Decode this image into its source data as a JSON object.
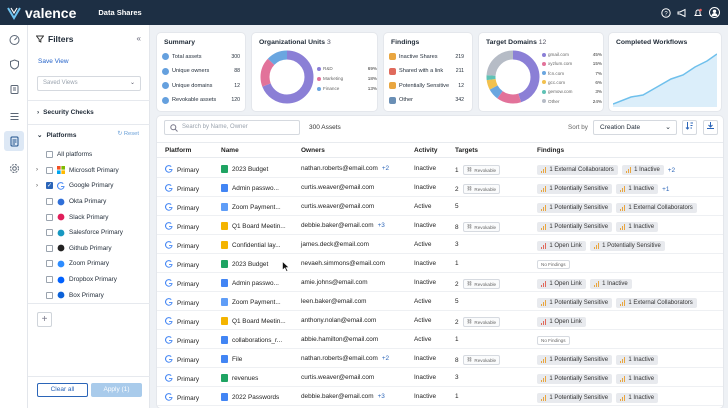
{
  "app": {
    "brand": "valence",
    "page_title": "Data Shares"
  },
  "filters": {
    "title": "Filters",
    "save_view": "Save View",
    "saved_views_placeholder": "Saved Views",
    "security_checks": "Security Checks",
    "platforms": "Platforms",
    "reset": "Reset",
    "items": [
      {
        "label": "All platforms",
        "checked": false,
        "icon": "all-icon"
      },
      {
        "label": "Microsoft Primary",
        "checked": false,
        "icon": "microsoft-icon",
        "expandable": true
      },
      {
        "label": "Google Primary",
        "checked": true,
        "icon": "google-icon",
        "expandable": true
      },
      {
        "label": "Okta Primary",
        "checked": false,
        "icon": "okta-icon"
      },
      {
        "label": "Slack Primary",
        "checked": false,
        "icon": "slack-icon"
      },
      {
        "label": "Salesforce Primary",
        "checked": false,
        "icon": "salesforce-icon"
      },
      {
        "label": "Github Primary",
        "checked": false,
        "icon": "github-icon"
      },
      {
        "label": "Zoom Primary",
        "checked": false,
        "icon": "zoom-icon"
      },
      {
        "label": "Dropbox Primary",
        "checked": false,
        "icon": "dropbox-icon"
      },
      {
        "label": "Box Primary",
        "checked": false,
        "icon": "box-icon"
      }
    ],
    "clear_all": "Clear all",
    "apply": "Apply (1)"
  },
  "summary": {
    "title": "Summary",
    "rows": [
      {
        "label": "Total assets",
        "value": "300",
        "color": "#4a8fd8"
      },
      {
        "label": "Unique owners",
        "value": "88",
        "color": "#4a8fd8"
      },
      {
        "label": "Unique domains",
        "value": "12",
        "color": "#4a8fd8"
      },
      {
        "label": "Revokable assets",
        "value": "120",
        "color": "#4a8fd8"
      }
    ]
  },
  "org_units": {
    "title": "Organizational Units",
    "count": "3",
    "legend": [
      {
        "label": "R&D",
        "value": "69%",
        "color": "#8b7fd6"
      },
      {
        "label": "Marketing",
        "value": "18%",
        "color": "#e2729a"
      },
      {
        "label": "Finance",
        "value": "13%",
        "color": "#6aa6e0"
      }
    ]
  },
  "findings": {
    "title": "Findings",
    "rows": [
      {
        "label": "Inactive Shares",
        "value": "219",
        "color": "#e9a640"
      },
      {
        "label": "Shared with a link",
        "value": "211",
        "color": "#e06a5c"
      },
      {
        "label": "Potentially Sensitive",
        "value": "12",
        "color": "#e9a640"
      },
      {
        "label": "Other",
        "value": "342",
        "color": "#6a8fb5"
      }
    ]
  },
  "target_domains": {
    "title": "Target Domains",
    "count": "12",
    "legend": [
      {
        "label": "gmail.com",
        "value": "45%",
        "color": "#8b7fd6"
      },
      {
        "label": "xyzlum.com",
        "value": "15%",
        "color": "#e2729a"
      },
      {
        "label": "fcn.com",
        "value": "7%",
        "color": "#6aa6e0"
      },
      {
        "label": "gcc.com",
        "value": "6%",
        "color": "#f2c14e"
      },
      {
        "label": "gemow.com",
        "value": "3%",
        "color": "#5fc2b5"
      },
      {
        "label": "Other",
        "value": "24%",
        "color": "#b6bcc6"
      }
    ]
  },
  "workflows": {
    "title": "Completed Workflows"
  },
  "toolbar": {
    "search_placeholder": "Search by Name, Owner",
    "assets_count": "300 Assets",
    "sort_by": "Sort by",
    "sort_value": "Creation Date"
  },
  "table": {
    "columns": [
      "Platform",
      "Name",
      "Owners",
      "Activity",
      "Targets",
      "Findings"
    ],
    "rows": [
      {
        "platform": "Primary",
        "name": "2023 Budget",
        "ftype": "sheet",
        "owner": "nathan.roberts@email.com",
        "extra": "+2",
        "activity": "Inactive",
        "targets": "1",
        "revokable": true,
        "findings": [
          {
            "t": "1 External Collaborators",
            "s": "y"
          },
          {
            "t": "1 Inactive",
            "s": "y"
          }
        ],
        "fmore": "+2"
      },
      {
        "platform": "Primary",
        "name": "Admin passwo...",
        "ftype": "doc",
        "owner": "curtis.weaver@email.com",
        "extra": "",
        "activity": "Inactive",
        "targets": "2",
        "revokable": true,
        "findings": [
          {
            "t": "1 Potentially Sensitive",
            "s": "y"
          },
          {
            "t": "1 Inactive",
            "s": "y"
          }
        ],
        "fmore": "+1"
      },
      {
        "platform": "Primary",
        "name": "Zoom Payment...",
        "ftype": "slides",
        "owner": "curtis.weaver@email.com",
        "extra": "",
        "activity": "Active",
        "targets": "5",
        "revokable": false,
        "findings": [
          {
            "t": "1 Potentially Sensitive",
            "s": "y"
          },
          {
            "t": "1 External Collaborators",
            "s": "y"
          }
        ],
        "fmore": ""
      },
      {
        "platform": "Primary",
        "name": "Q1 Board Meetin...",
        "ftype": "pdf",
        "owner": "debbie.baker@email.com",
        "extra": "+3",
        "activity": "Inactive",
        "targets": "8",
        "revokable": true,
        "findings": [
          {
            "t": "1 Potentially Sensitive",
            "s": "y"
          },
          {
            "t": "1 Inactive",
            "s": "y"
          }
        ],
        "fmore": ""
      },
      {
        "platform": "Primary",
        "name": "Confidential lay...",
        "ftype": "pdf",
        "owner": "james.deck@email.com",
        "extra": "",
        "activity": "Active",
        "targets": "3",
        "revokable": false,
        "findings": [
          {
            "t": "1 Open Link",
            "s": "r"
          },
          {
            "t": "1 Potentially Sensitive",
            "s": "y"
          }
        ],
        "fmore": ""
      },
      {
        "platform": "Primary",
        "name": "2023 Budget",
        "ftype": "sheet",
        "owner": "nevaeh.simmons@email.com",
        "extra": "",
        "activity": "Inactive",
        "targets": "1",
        "revokable": false,
        "findings": [],
        "nofindings": "No Findings",
        "fmore": ""
      },
      {
        "platform": "Primary",
        "name": "Admin passwo...",
        "ftype": "doc",
        "owner": "amie.johns@email.com",
        "extra": "",
        "activity": "Inactive",
        "targets": "2",
        "revokable": true,
        "findings": [
          {
            "t": "1 Open Link",
            "s": "r"
          },
          {
            "t": "1 Inactive",
            "s": "y"
          }
        ],
        "fmore": ""
      },
      {
        "platform": "Primary",
        "name": "Zoom Payment...",
        "ftype": "slides",
        "owner": "leen.baker@email.com",
        "extra": "",
        "activity": "Active",
        "targets": "5",
        "revokable": false,
        "findings": [
          {
            "t": "1 Potentially Sensitive",
            "s": "y"
          },
          {
            "t": "1 External Collaborators",
            "s": "y"
          }
        ],
        "fmore": ""
      },
      {
        "platform": "Primary",
        "name": "Q1 Board Meetin...",
        "ftype": "pdf",
        "owner": "anthony.nolan@email.com",
        "extra": "",
        "activity": "Active",
        "targets": "2",
        "revokable": true,
        "findings": [
          {
            "t": "1 Open Link",
            "s": "r"
          }
        ],
        "fmore": ""
      },
      {
        "platform": "Primary",
        "name": "collaborations_r...",
        "ftype": "doc",
        "owner": "abbie.hamilton@email.com",
        "extra": "",
        "activity": "Active",
        "targets": "1",
        "revokable": false,
        "findings": [],
        "nofindings": "No Findings",
        "fmore": ""
      },
      {
        "platform": "Primary",
        "name": "File",
        "ftype": "doc",
        "owner": "nathan.roberts@email.com",
        "extra": "+2",
        "activity": "Inactive",
        "targets": "8",
        "revokable": true,
        "findings": [
          {
            "t": "1 Potentially Sensitive",
            "s": "y"
          },
          {
            "t": "1 Inactive",
            "s": "y"
          }
        ],
        "fmore": ""
      },
      {
        "platform": "Primary",
        "name": "revenues",
        "ftype": "sheet",
        "owner": "curtis.weaver@email.com",
        "extra": "",
        "activity": "Inactive",
        "targets": "3",
        "revokable": false,
        "findings": [
          {
            "t": "1 Potentially Sensitive",
            "s": "y"
          },
          {
            "t": "1 Inactive",
            "s": "y"
          }
        ],
        "fmore": ""
      },
      {
        "platform": "Primary",
        "name": "2022 Passwords",
        "ftype": "doc",
        "owner": "debbie.baker@email.com",
        "extra": "+3",
        "activity": "Inactive",
        "targets": "1",
        "revokable": false,
        "findings": [
          {
            "t": "1 Potentially Sensitive",
            "s": "y"
          },
          {
            "t": "1 Inactive",
            "s": "y"
          }
        ],
        "fmore": ""
      }
    ],
    "revokable_label": "Revokable"
  }
}
